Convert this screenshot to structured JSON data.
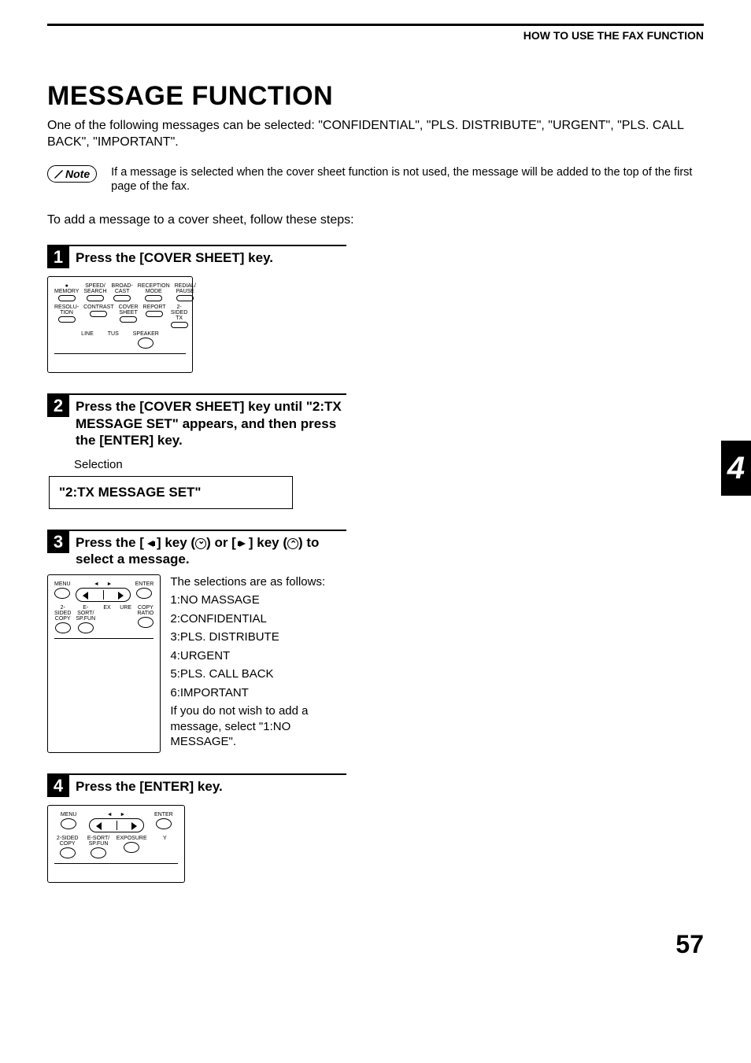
{
  "header": {
    "title": "HOW TO USE THE FAX FUNCTION"
  },
  "main": {
    "heading": "MESSAGE FUNCTION",
    "intro": "One of the following messages can be selected: \"CONFIDENTIAL\", \"PLS. DISTRIBUTE\", \"URGENT\", \"PLS. CALL BACK\", \"IMPORTANT\".",
    "note_label": "Note",
    "note_text": "If a message is selected when the cover sheet function is not used, the message will be added to the top of the first page of the fax.",
    "lead_in": "To add a message to a cover sheet, follow these steps:"
  },
  "chapter_tab": "4",
  "page_number": "57",
  "steps": [
    {
      "num": "1",
      "title": "Press the [COVER SHEET] key.",
      "panel_keys": {
        "row1": [
          "MEMORY",
          "SPEED/\nSEARCH",
          "BROAD-\nCAST",
          "RECEPTION\nMODE",
          "REDIAL/\nPAUSE"
        ],
        "row2": [
          "RESOLU-\nTION",
          "CONTRAST",
          "COVER\nSHEET",
          "REPORT",
          "2-SIDED TX"
        ],
        "row3_left": "LINE",
        "row3_mid": "TUS",
        "row3_right": "SPEAKER"
      }
    },
    {
      "num": "2",
      "title": "Press the [COVER SHEET] key until \"2:TX MESSAGE SET\" appears, and then press the [ENTER] key.",
      "selection_label": "Selection",
      "lcd": "\"2:TX MESSAGE SET\""
    },
    {
      "num": "3",
      "title_pre": "Press the [",
      "title_mid1": "] key (",
      "title_mid2": ") or [",
      "title_mid3": "] key (",
      "title_post": ") to select a message.",
      "panel_keys": {
        "top": [
          "MENU",
          "",
          "",
          "ENTER"
        ],
        "bottom": [
          "2-SIDED\nCOPY",
          "E-SORT/\nSP.FUN",
          "EX",
          "URE",
          "COPY\nRATIO"
        ]
      },
      "right": {
        "intro": "The selections are as follows:",
        "items": [
          "1:NO MASSAGE",
          "2:CONFIDENTIAL",
          "3:PLS. DISTRIBUTE",
          "4:URGENT",
          "5:PLS. CALL BACK",
          "6:IMPORTANT"
        ],
        "tail": "If you do not wish to add a message, select \"1:NO MESSAGE\"."
      }
    },
    {
      "num": "4",
      "title": "Press the [ENTER] key.",
      "panel_keys": {
        "top": [
          "MENU",
          "",
          "",
          "ENTER"
        ],
        "bottom": [
          "2-SIDED\nCOPY",
          "E-SORT/\nSP.FUN",
          "EXPOSURE",
          "Y"
        ]
      }
    }
  ]
}
